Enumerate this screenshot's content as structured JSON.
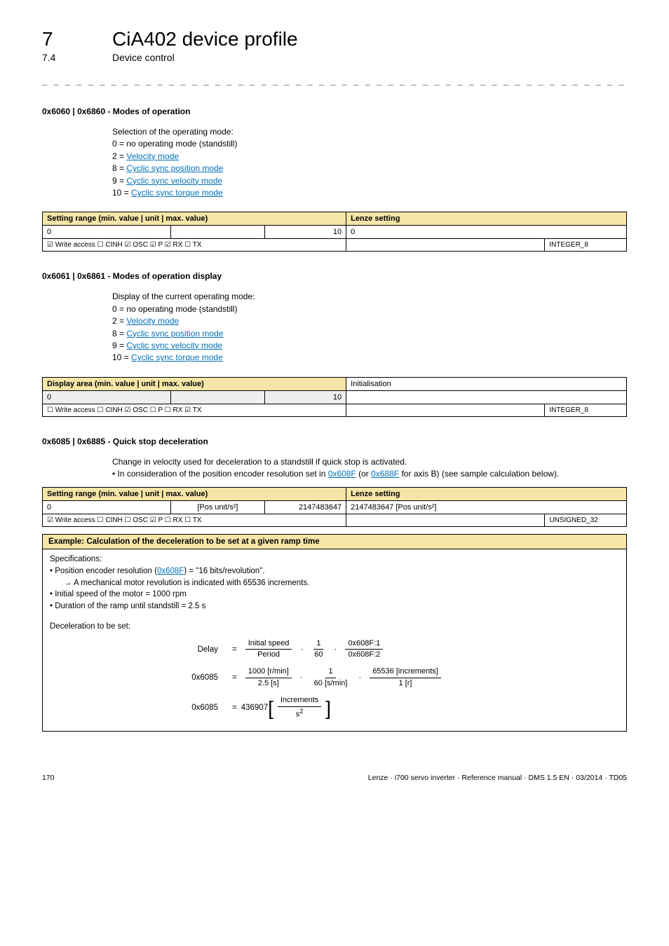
{
  "header": {
    "chapnum": "7",
    "chaptitle": "CiA402 device profile",
    "subnum": "7.4",
    "subtitle": "Device control",
    "dashes": "_ _ _ _ _ _ _ _ _ _ _ _ _ _ _ _ _ _ _ _ _ _ _ _ _ _ _ _ _ _ _ _ _ _ _ _ _ _ _ _ _ _ _ _ _ _ _ _ _ _ _ _ _ _ _ _ _ _ _ _ _ _ _ _"
  },
  "p1": {
    "heading": "0x6060 | 0x6860 - Modes of operation",
    "desc": "Selection of the operating mode:",
    "l0": "0 = no operating mode (standstill)",
    "l2p": "2 = ",
    "l2a": "Velocity mode",
    "l8p": "8 = ",
    "l8a": "Cyclic sync position mode",
    "l9p": "9 = ",
    "l9a": "Cyclic sync velocity mode",
    "l10p": "10 = ",
    "l10a": "Cyclic sync torque mode",
    "range_label": "Setting range (min. value | unit | max. value)",
    "setting_label": "Lenze setting",
    "min": "0",
    "unit": "",
    "max": "10",
    "setting": "0",
    "access": "☑ Write access   ☐ CINH   ☑ OSC   ☑ P   ☑ RX   ☐ TX",
    "dtype": "INTEGER_8"
  },
  "p2": {
    "heading": "0x6061 | 0x6861 - Modes of operation display",
    "desc": "Display of the current operating mode:",
    "l0": "0 = no operating mode (standstill)",
    "l2p": "2 = ",
    "l2a": "Velocity mode",
    "l8p": "8 = ",
    "l8a": "Cyclic sync position mode",
    "l9p": "9 = ",
    "l9a": "Cyclic sync velocity mode",
    "l10p": "10 = ",
    "l10a": "Cyclic sync torque mode",
    "range_label": "Display area (min. value | unit | max. value)",
    "setting_label": "Initialisation",
    "min": "0",
    "unit": "",
    "max": "10",
    "setting": "",
    "access": "☐ Write access   ☐ CINH   ☑ OSC   ☐ P   ☐ RX   ☑ TX",
    "dtype": "INTEGER_8"
  },
  "p3": {
    "heading": "0x6085 | 0x6885 - Quick stop deceleration",
    "desc": "Change in velocity used for deceleration to a standstill if quick stop is activated.",
    "bullet_pre": " • In consideration of the position encoder resolution set in ",
    "bullet_l1": "0x608F",
    "bullet_mid": " (or ",
    "bullet_l2": "0x688F",
    "bullet_post": " for axis B) (see sample calculation below).",
    "range_label": "Setting range (min. value | unit | max. value)",
    "setting_label": "Lenze setting",
    "min": "0",
    "unit": "[Pos unit/s²]",
    "max": "2147483647",
    "setting": "2147483647 [Pos unit/s²]",
    "access": "☑ Write access   ☐ CINH   ☐ OSC   ☑ P   ☐ RX   ☐ TX",
    "dtype": "UNSIGNED_32"
  },
  "example": {
    "title": "Example: Calculation of the deceleration to be set at a given ramp time",
    "spec": "Specifications:",
    "b1p": " • Position encoder resolution (",
    "b1a": "0x608F",
    "b1s": ") = \"16 bits/revolution\".",
    "b1arrow": "→ A mechanical motor revolution is indicated with 65536 increments.",
    "b2": " • Initial speed of the motor = 1000 rpm",
    "b3": " • Duration of the ramp until standstill = 2.5 s",
    "decel": "Deceleration to be set:",
    "row1_label": "Delay",
    "row1_eq1n": "Initial speed",
    "row1_eq1d": "Period",
    "row1_eq2n": "1",
    "row1_eq2d": "60",
    "row1_eq3n": "0x608F:1",
    "row1_eq3d": "0x608F:2",
    "row2_label": "0x6085",
    "row2_eq1n": "1000 [r/min]",
    "row2_eq1d": "2.5 [s]",
    "row2_eq2n": "1",
    "row2_eq2d": "60 [s/min]",
    "row2_eq3n": "65536 [increments]",
    "row2_eq3d": "1 [r]",
    "row3_label": "0x6085",
    "row3_val": "436907",
    "row3_bn": "Increments",
    "row3_bd": "s",
    "row3_exp": "2"
  },
  "footer": {
    "page": "170",
    "text": "Lenze · i700 servo inverter · Reference manual · DMS 1.5 EN · 03/2014 · TD05"
  }
}
